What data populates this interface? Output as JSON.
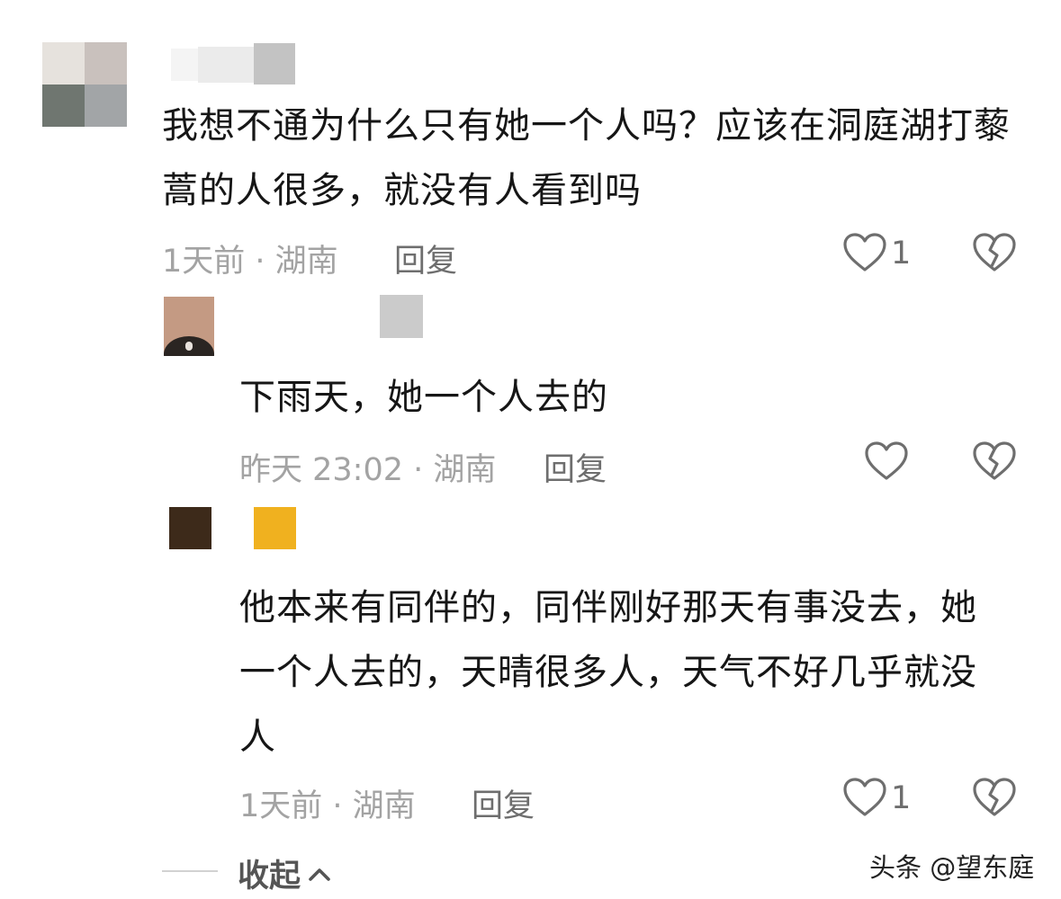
{
  "comments": [
    {
      "text": "我想不通为什么只有她一个人吗？应该在洞庭湖打藜蒿的人很多，就没有人看到吗",
      "time": "1天前",
      "location": "湖南",
      "reply_label": "回复",
      "like_count": "1"
    },
    {
      "text": "下雨天，她一个人去的",
      "time": "昨天 23:02",
      "location": "湖南",
      "reply_label": "回复"
    },
    {
      "text": "他本来有同伴的，同伴刚好那天有事没去，她一个人去的，天晴很多人，天气不好几乎就没人",
      "time": "1天前",
      "location": "湖南",
      "reply_label": "回复",
      "like_count": "1"
    }
  ],
  "collapse_label": "收起",
  "watermark": "头条 @望东庭",
  "meta_separator": " · ",
  "icons": {
    "like": "heart-outline-icon",
    "dislike": "broken-heart-icon",
    "collapse": "chevron-up-icon"
  },
  "colors": {
    "text": "#161616",
    "meta": "#a3a3a3",
    "icon": "#6e6e6e"
  }
}
